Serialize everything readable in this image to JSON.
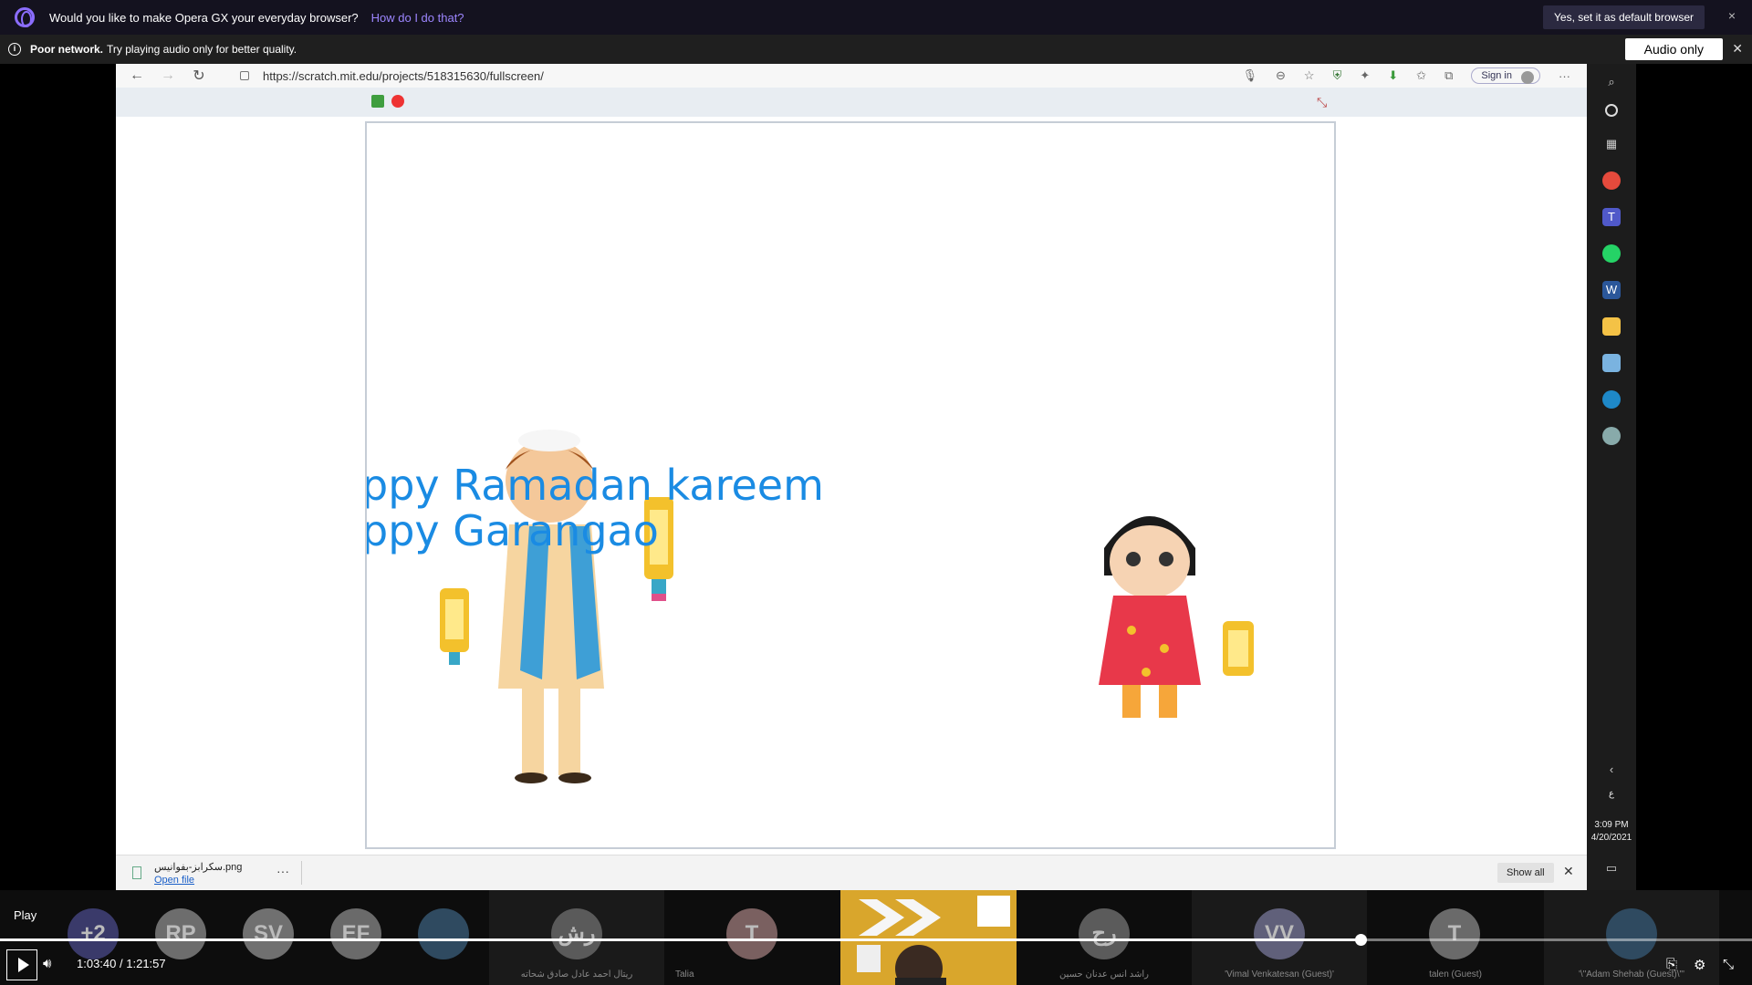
{
  "opera_banner": {
    "question": "Would you like to make Opera GX your everyday browser?",
    "link": "How do I do that?",
    "default_button": "Yes, set it as default browser",
    "close": "×"
  },
  "network_notice": {
    "bold": "Poor network.",
    "message": "Try playing audio only for better quality.",
    "audio_only_button": "Audio only",
    "close": "✕"
  },
  "browser": {
    "url": "https://scratch.mit.edu/projects/518315630/fullscreen/",
    "sign_in": "Sign in",
    "stage_text_line1": "ppy Ramadan kareem",
    "stage_text_line2": "ppy Garangao",
    "download": {
      "file_name": "سكرابز-بفوانيس.png",
      "open_file": "Open file",
      "more": "···",
      "show_all": "Show all",
      "close": "✕"
    },
    "sidebar": {
      "lang": "ع",
      "time": "3:09 PM",
      "date": "4/20/2021"
    }
  },
  "participants": [
    {
      "initials": "+2",
      "name": ""
    },
    {
      "initials": "RP",
      "name": ""
    },
    {
      "initials": "SV",
      "name": ""
    },
    {
      "initials": "EF",
      "name": ""
    },
    {
      "initials": "",
      "name": ""
    },
    {
      "initials": "رش",
      "name": "ريتال احمد عادل صادق شحاته"
    },
    {
      "initials": "T",
      "name": "Talia"
    },
    {
      "initials": "رح",
      "name": "راشد انس عدنان حسين"
    },
    {
      "initials": "VV",
      "name": "'Vimal Venkatesan (Guest)'"
    },
    {
      "initials": "T",
      "name": "talen (Guest)"
    },
    {
      "initials": "",
      "name": "'\\\"Adam Shehab (Guest)\\\"'"
    }
  ],
  "player": {
    "play_tooltip": "Play",
    "current_time": "1:03:40",
    "separator": "/",
    "duration": "1:21:57",
    "progress": 0.7767
  }
}
